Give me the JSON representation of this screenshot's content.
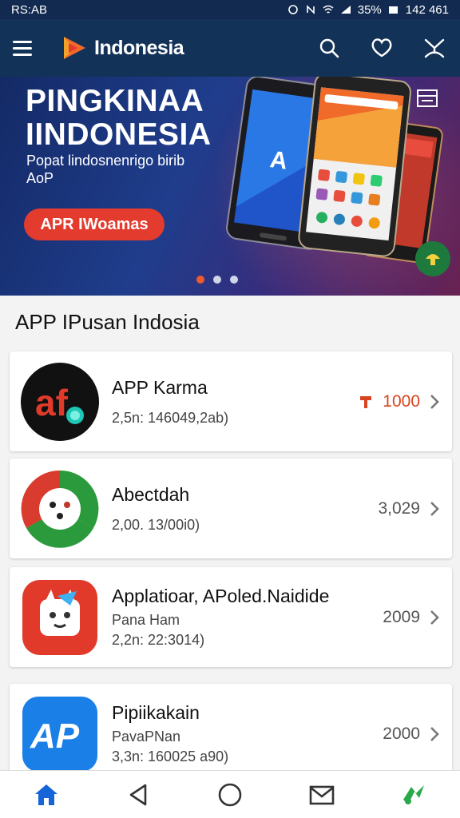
{
  "status_bar": {
    "left_text": "RS:AB",
    "battery": "35%",
    "time": "142 461"
  },
  "app_bar": {
    "title": "Indonesia"
  },
  "banner": {
    "title_line1": "PINGKINAA",
    "title_line2": "IINDONESIA",
    "subtitle": "Popat lindosnenrigo birib AoP",
    "cta_label": "APR IWoamas",
    "pages": 3,
    "active_page": 1
  },
  "section": {
    "title": "APP IPusan Indosia"
  },
  "apps": [
    {
      "name": "APP Karma",
      "sub": "",
      "stat": "2,5n: 146049,2ab)",
      "value": "1000"
    },
    {
      "name": "Abectdah",
      "sub": "",
      "stat": "2,00. 13/00i0)",
      "value": "3,029"
    },
    {
      "name": "Applatioar, APoled.Naidide",
      "sub": "Pana Ham",
      "stat": "2,2n: 22:3014)",
      "value": "2009"
    },
    {
      "name": "Pipiikakain",
      "sub": "PavaPNan",
      "stat": "3,3n: 160025 a90)",
      "value": "2000"
    }
  ],
  "colors": {
    "header": "#133258",
    "accent": "#e33b2e",
    "nav_active": "#1565d8",
    "promo_green": "#1d7a3c"
  },
  "nav": [
    "home-icon",
    "back-icon",
    "circle-home-icon",
    "mail-icon",
    "brand-icon"
  ]
}
